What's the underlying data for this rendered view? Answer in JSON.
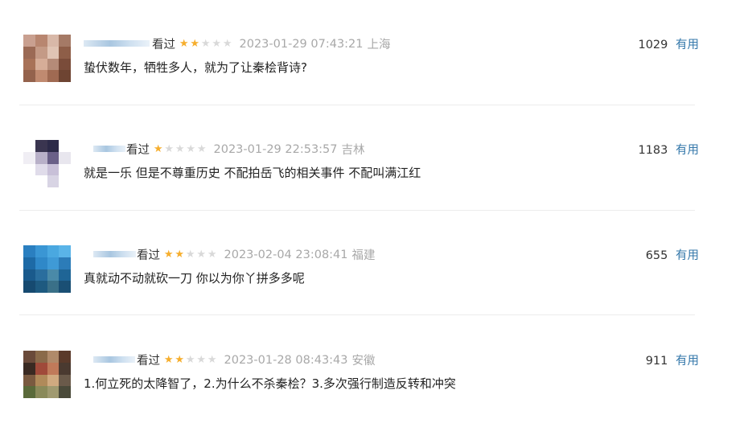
{
  "comments": [
    {
      "status": "看过",
      "rating": 2,
      "time": "2023-01-29 07:43:21",
      "location": "上海",
      "votes": "1029",
      "useful_label": "有用",
      "text": "蛰伏数年，牺牲多人，就为了让秦桧背诗?"
    },
    {
      "status": "看过",
      "rating": 1,
      "time": "2023-01-29 22:53:57",
      "location": "吉林",
      "votes": "1183",
      "useful_label": "有用",
      "text": "就是一乐 但是不尊重历史 不配拍岳飞的相关事件 不配叫满江红"
    },
    {
      "status": "看过",
      "rating": 2,
      "time": "2023-02-04 23:08:41",
      "location": "福建",
      "votes": "655",
      "useful_label": "有用",
      "text": "真就动不动就砍一刀 你以为你丫拼多多呢"
    },
    {
      "status": "看过",
      "rating": 2,
      "time": "2023-01-28 08:43:43",
      "location": "安徽",
      "votes": "911",
      "useful_label": "有用",
      "text": "1.何立死的太降智了，2.为什么不杀秦桧？3.多次强行制造反转和冲突"
    }
  ]
}
